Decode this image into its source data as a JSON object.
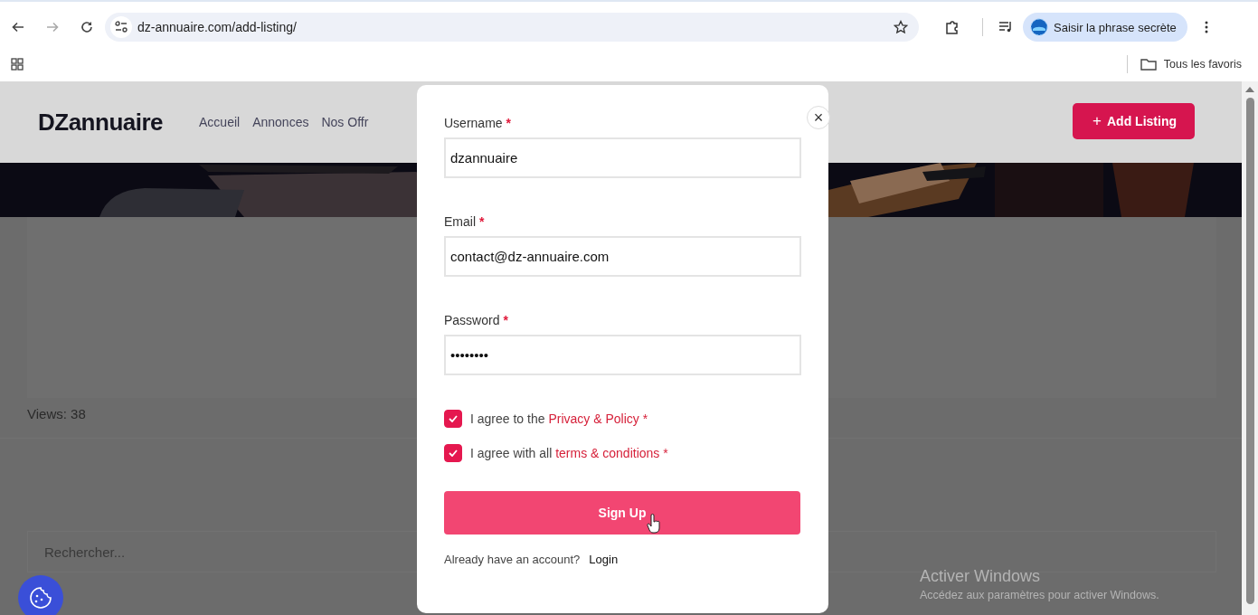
{
  "browser": {
    "url": "dz-annuaire.com/add-listing/",
    "forward_disabled": true,
    "profile_button": "Saisir la phrase secrète",
    "bookmarks_folder": "Tous les favoris"
  },
  "site": {
    "logo": "DZannuaire",
    "nav": [
      {
        "label": "Accueil"
      },
      {
        "label": "Annonces"
      },
      {
        "label": "Nos Offr"
      }
    ],
    "add_listing": {
      "icon": "+",
      "label": "Add Listing"
    },
    "views": "Views: 38",
    "search_placeholder": "Rechercher..."
  },
  "modal": {
    "close": "×",
    "fields": [
      {
        "label": "Username",
        "required_mark": "*",
        "value": "dzannuaire"
      },
      {
        "label": "Email",
        "required_mark": "*",
        "value": "contact@dz-annuaire.com"
      },
      {
        "label": "Password",
        "required_mark": "*",
        "value": "••••••••"
      }
    ],
    "checkboxes": [
      {
        "prefix": "I agree to the ",
        "link": "Privacy & Policy",
        "suffix": " *",
        "checked": true
      },
      {
        "prefix": "I agree with all ",
        "link": "terms & conditions",
        "suffix": " *",
        "checked": true
      }
    ],
    "submit": "Sign Up",
    "footer_text": "Already have an account?",
    "login_link": "Login"
  },
  "os_notice": {
    "title": "Activer Windows",
    "subtitle": "Accédez aux paramètres pour activer Windows."
  }
}
